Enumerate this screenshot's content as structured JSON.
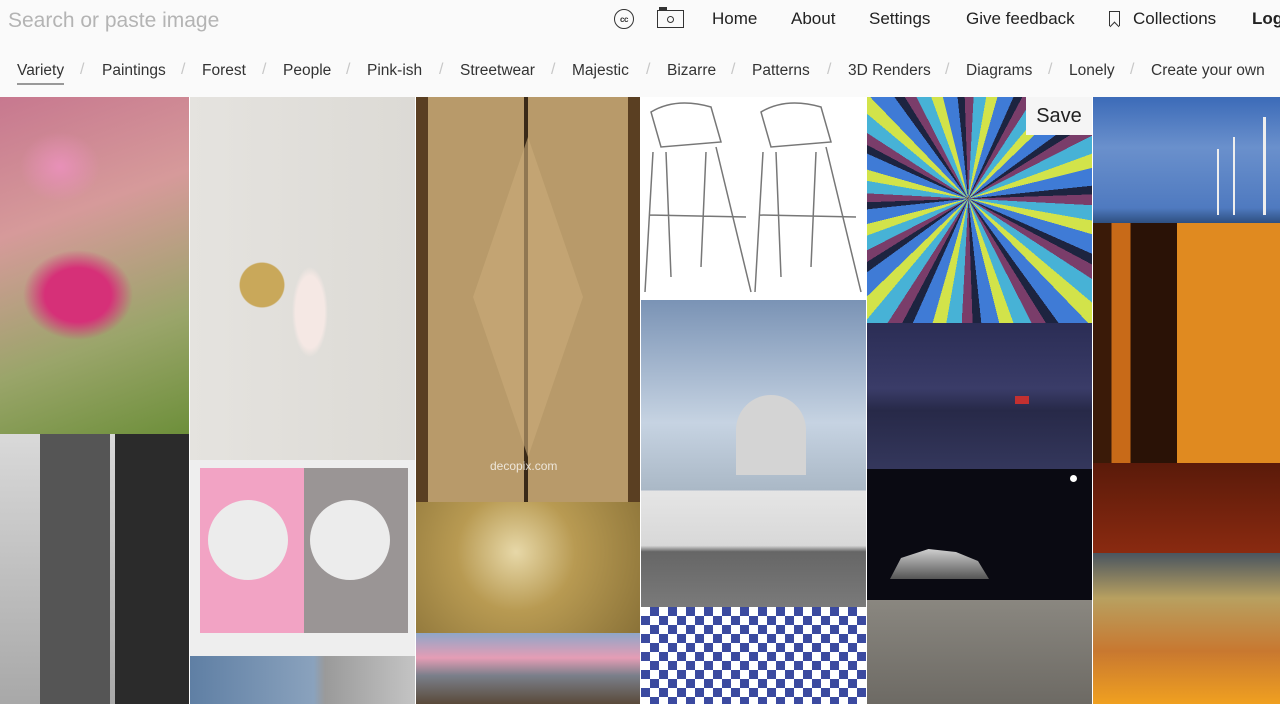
{
  "header": {
    "search_placeholder": "Search or paste image",
    "icons": [
      "cc-license-icon",
      "camera-icon",
      "bookmark-icon"
    ],
    "nav": [
      {
        "label": "Home"
      },
      {
        "label": "About"
      },
      {
        "label": "Settings"
      },
      {
        "label": "Give feedback"
      },
      {
        "label": "Collections"
      },
      {
        "label": "Log"
      }
    ]
  },
  "categories": {
    "active": "Variety",
    "items": [
      "Variety",
      "Paintings",
      "Forest",
      "People",
      "Pink-ish",
      "Streetwear",
      "Majestic",
      "Bizarre",
      "Patterns",
      "3D Renders",
      "Diagrams",
      "Lonely",
      "Create your own"
    ],
    "separator": "/"
  },
  "grid": {
    "save_label": "Save",
    "watermark": "decopix.com",
    "tiles": [
      {
        "subject": "pink heart-shaped bleeding heart flower"
      },
      {
        "subject": "black and white Chrysler Building skyscraper"
      },
      {
        "subject": "brass wall sconce lamp"
      },
      {
        "subject": "pink and gray abstract drawing"
      },
      {
        "subject": "blue glass building"
      },
      {
        "subject": "art deco brass elevator doors"
      },
      {
        "subject": "golden radial ceiling"
      },
      {
        "subject": "city skyline with pink clouds"
      },
      {
        "subject": "wire bar stools"
      },
      {
        "subject": "US Capitol building"
      },
      {
        "subject": "blue white geometric tile pattern"
      },
      {
        "subject": "colorful radial abstract painting"
      },
      {
        "subject": "night landscape painting with house"
      },
      {
        "subject": "Acropolis at night"
      },
      {
        "subject": "aerial archaeological ruins"
      },
      {
        "subject": "wind turbines by the sea"
      },
      {
        "subject": "sunlit misty forest"
      },
      {
        "subject": "golden sunset clouds"
      }
    ]
  }
}
